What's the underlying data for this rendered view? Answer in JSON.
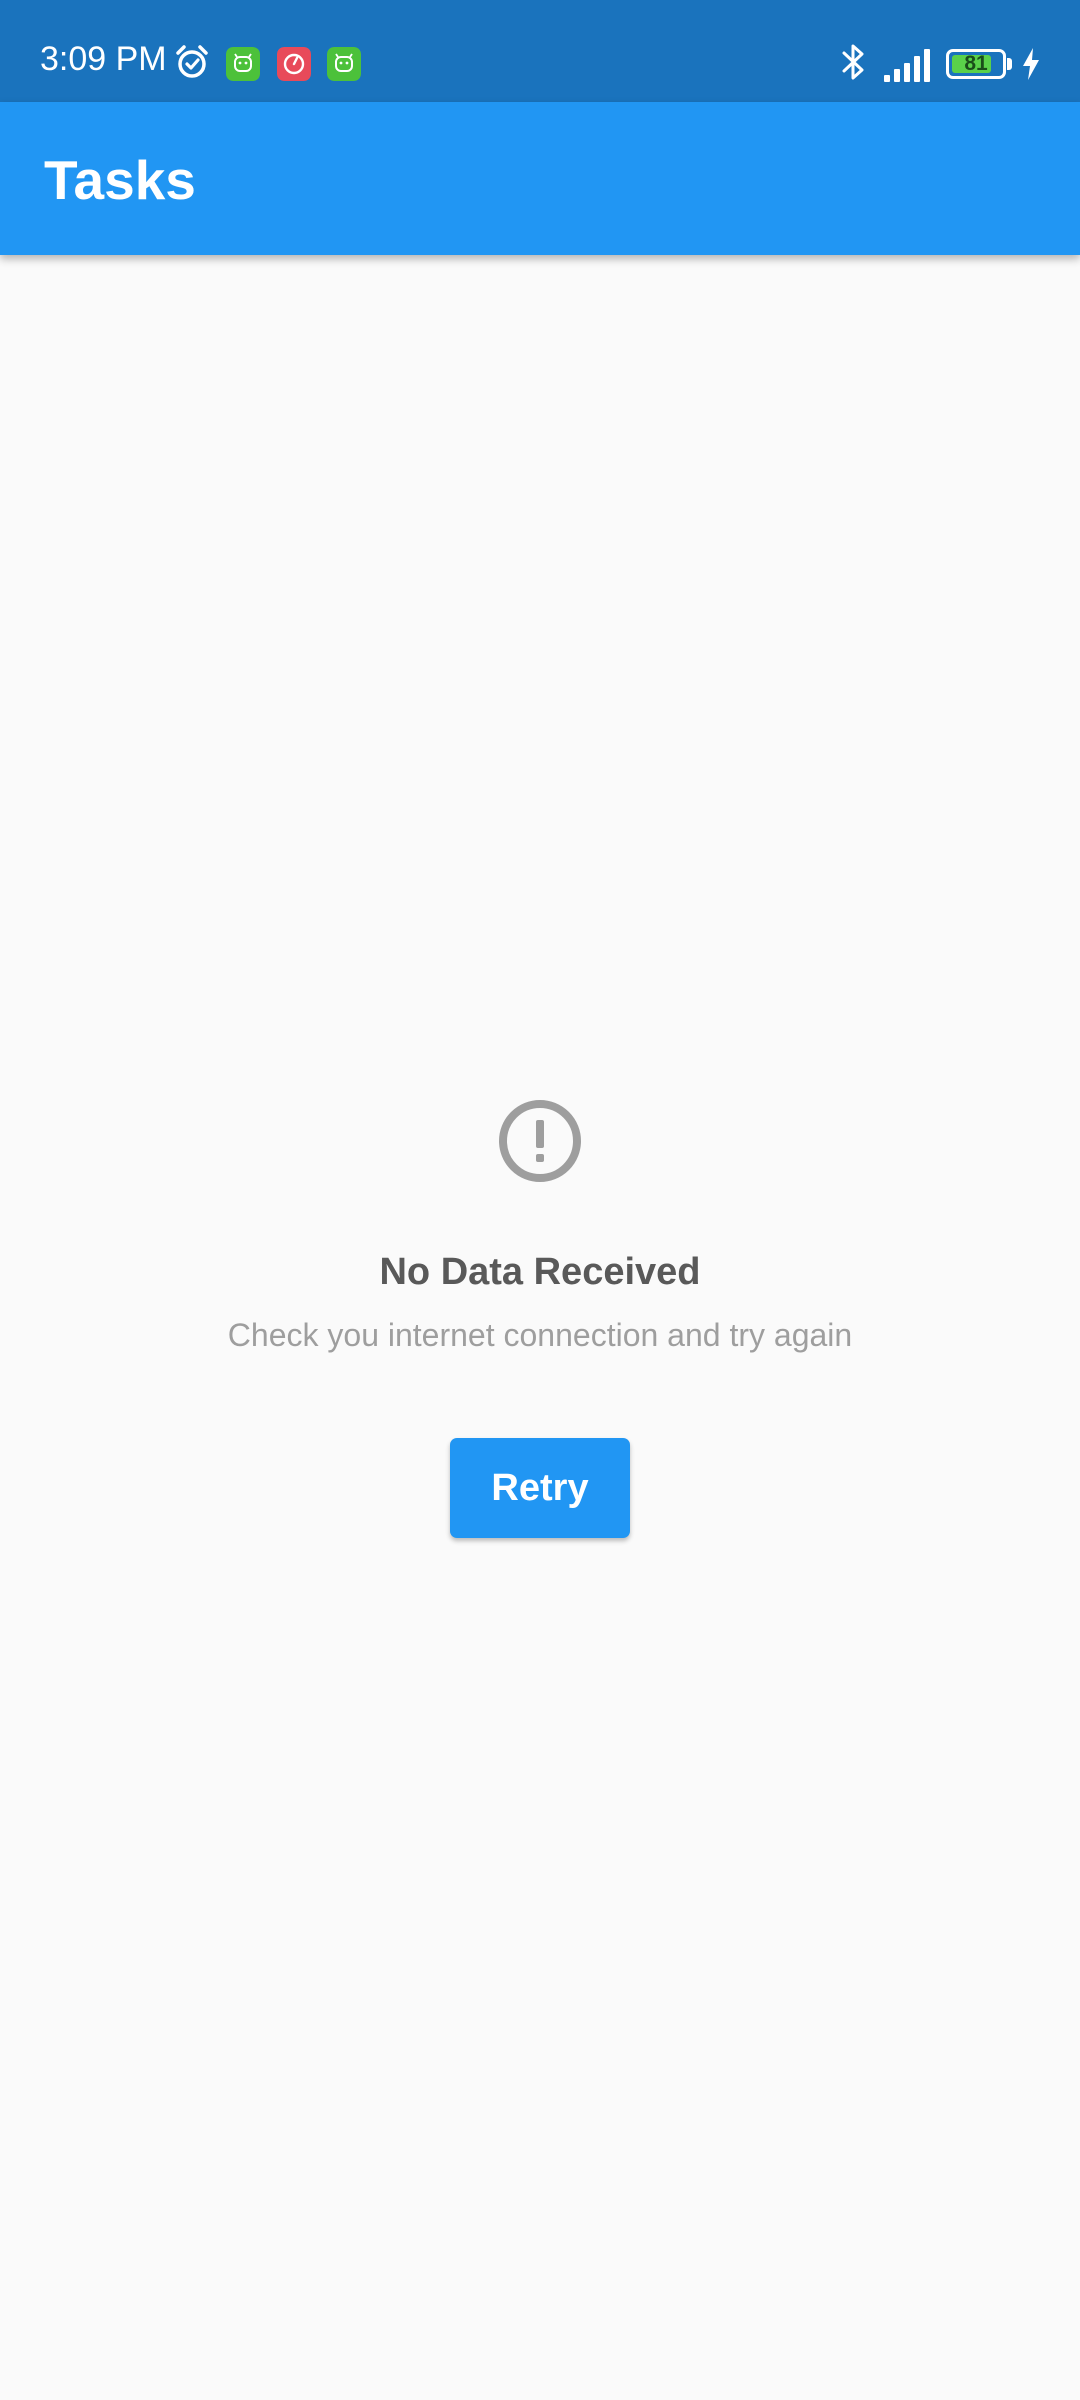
{
  "status_bar": {
    "time": "3:09 PM",
    "battery_level": "81",
    "battery_fraction": 0.81,
    "icons": [
      "alarm-icon",
      "android-notification-icon",
      "red-notification-icon",
      "android-notification-icon",
      "bluetooth-icon",
      "signal-icon",
      "battery-icon",
      "charging-icon"
    ]
  },
  "app_bar": {
    "title": "Tasks"
  },
  "empty_state": {
    "icon": "error-icon",
    "title": "No Data Received",
    "subtitle": "Check you internet connection and try again",
    "retry_label": "Retry"
  },
  "colors": {
    "status_bar": "#1a73bd",
    "app_bar": "#2196f3",
    "background": "#fafafa",
    "title_text": "#595959",
    "subtitle_text": "#9e9e9e",
    "notification_green": "#4cc13a",
    "notification_red": "#e84a5a"
  }
}
